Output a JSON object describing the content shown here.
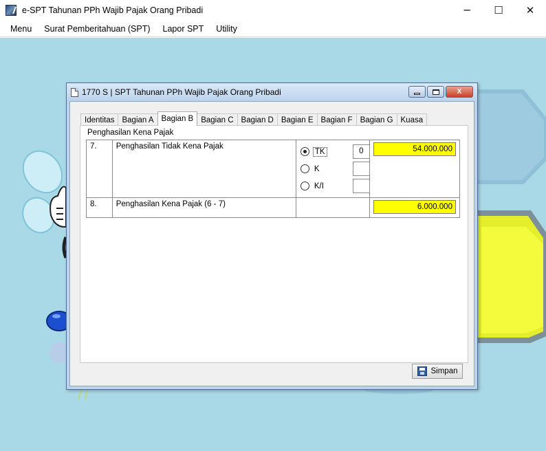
{
  "app": {
    "title": "e-SPT Tahunan PPh Wajib Pajak Orang Pribadi",
    "icon": "app-logo-icon",
    "controls": {
      "minimize": "─",
      "maximize": "☐",
      "close": "✕"
    }
  },
  "menubar": {
    "items": [
      "Menu",
      "Surat Pemberitahuan (SPT)",
      "Lapor SPT",
      "Utility"
    ]
  },
  "child_window": {
    "title": "1770 S | SPT Tahunan PPh Wajib Pajak Orang Pribadi",
    "controls": {
      "close": "X"
    },
    "tabs": [
      {
        "label": "Identitas",
        "active": false
      },
      {
        "label": "Bagian A",
        "active": false
      },
      {
        "label": "Bagian B",
        "active": true
      },
      {
        "label": "Bagian C",
        "active": false
      },
      {
        "label": "Bagian D",
        "active": false
      },
      {
        "label": "Bagian E",
        "active": false
      },
      {
        "label": "Bagian F",
        "active": false
      },
      {
        "label": "Bagian G",
        "active": false
      },
      {
        "label": "Kuasa",
        "active": false
      }
    ],
    "section_label": "Penghasilan Kena Pajak",
    "rows": [
      {
        "no": "7.",
        "desc": "Penghasilan Tidak Kena Pajak",
        "options": [
          {
            "label": "TK",
            "selected": true,
            "value": "0"
          },
          {
            "label": "K",
            "selected": false,
            "value": ""
          },
          {
            "label": "K/I",
            "selected": false,
            "value": ""
          }
        ],
        "value": "54.000.000"
      },
      {
        "no": "8.",
        "desc": "Penghasilan Kena Pajak (6 - 7)",
        "value": "6.000.000"
      }
    ],
    "save_label": "Simpan"
  },
  "colors": {
    "desktop": "#a9d8e6",
    "highlight_field": "#ffff00",
    "child_frame": "#bcd3ec",
    "close_button": "#c7422c"
  }
}
